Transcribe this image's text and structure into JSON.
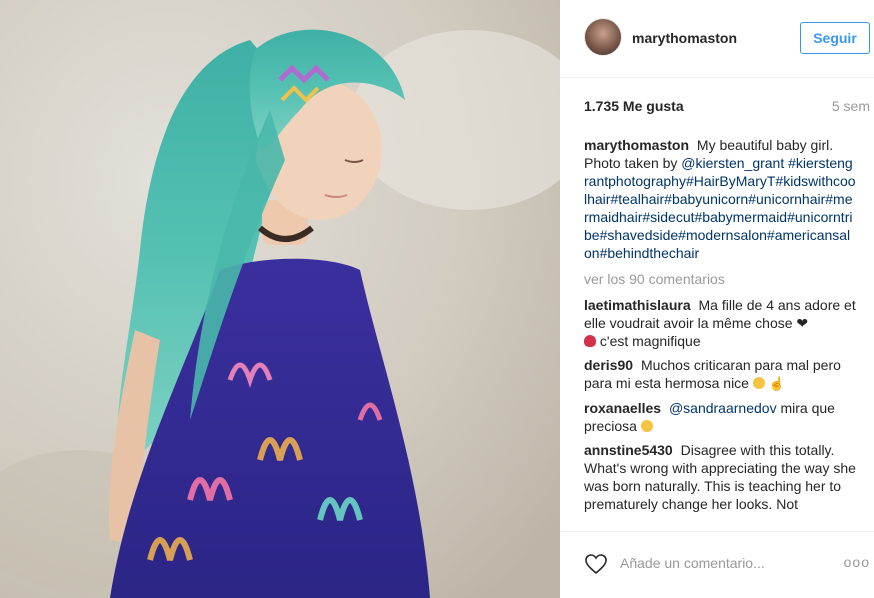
{
  "post": {
    "username": "marythomaston",
    "follow_label": "Seguir",
    "likes": "1.735 Me gusta",
    "age": "5 sem",
    "caption_user": "marythomaston",
    "caption_text": "My beautiful baby girl. Photo taken by",
    "caption_mention": "@kiersten_grant",
    "caption_hashtags": "#kierstengrantphotography#HairByMaryT#kidswithcoolhair#tealhair#babyunicorn#unicornhair#mermaidhair#sidecut#babymermaid#unicorntribe#shavedside#modernsalon#americansalon#behindthechair",
    "view_all": "ver los 90 comentarios",
    "comments": [
      {
        "user": "laetimathislaura",
        "text": "Ma fille de 4 ans adore et elle voudrait avoir la même chose ❤",
        "text2": "c'est magnifique"
      },
      {
        "user": "deris90",
        "text": "Muchos criticaran para mal pero para mi esta hermosa nice"
      },
      {
        "user": "roxanaelles",
        "mention": "@sandraarnedov",
        "text": "mira que preciosa"
      },
      {
        "user": "annstine5430",
        "text": "Disagree with this totally. What's wrong with appreciating the way she was born naturally. This is teaching her to prematurely change her looks. Not"
      }
    ],
    "add_comment_placeholder": "Añade un comentario...",
    "more_label": "ooo"
  },
  "colors": {
    "accent": "#3897f0",
    "link": "#003569",
    "muted": "#999999"
  }
}
